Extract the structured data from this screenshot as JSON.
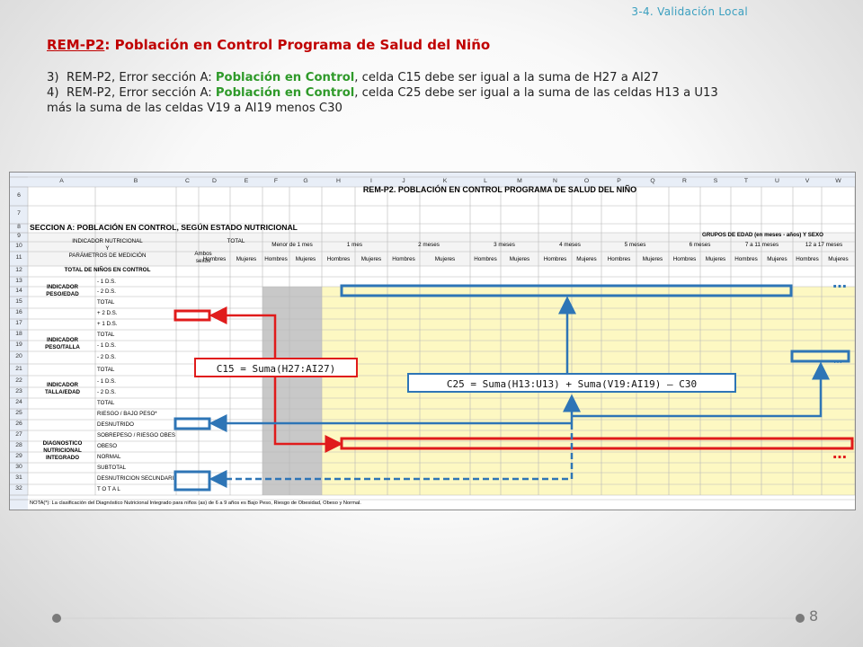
{
  "header": {
    "section_tag": "3-4. Validación Local"
  },
  "title": {
    "code": "REM-P2",
    "text": ": Población en Control  Programa de Salud del Niño"
  },
  "notes": [
    {
      "num": "3)",
      "pre": "REM-P2, Error sección A: ",
      "highlight": "Población en Control",
      "post": ", celda C15 debe ser igual a la suma de H27 a AI27"
    },
    {
      "num": "4)",
      "pre": "REM-P2, Error sección A: ",
      "highlight": "Población en Control",
      "post": ", celda C25 debe ser igual a la suma de las celdas H13 a U13",
      "continuation": "más la suma  de las celdas V19 a AI19 menos C30"
    }
  ],
  "sheet": {
    "col_letters": [
      "A",
      "B",
      "C",
      "D",
      "E",
      "F",
      "G",
      "H",
      "I",
      "J",
      "K",
      "L",
      "M",
      "N",
      "O",
      "P",
      "Q",
      "R",
      "S",
      "T",
      "U",
      "V",
      "W"
    ],
    "row_numbers": [
      "6",
      "7",
      "8",
      "9",
      "10",
      "11",
      "12",
      "13",
      "14",
      "15",
      "16",
      "17",
      "18",
      "19",
      "20",
      "21",
      "22",
      "23",
      "24",
      "25",
      "26",
      "27",
      "28",
      "29",
      "30",
      "31",
      "32"
    ],
    "title": "REM-P2.  POBLACIÓN EN CONTROL PROGRAMA DE SALUD DEL NIÑO",
    "section": "SECCION A: POBLACIÓN EN CONTROL, SEGÚN ESTADO NUTRICIONAL",
    "grupos_edad": "GRUPOS DE EDAD (en meses - años) Y SEXO",
    "indicador_header": [
      "INDICADOR NUTRICIONAL",
      "Y",
      "PARÁMETROS DE MEDICIÓN"
    ],
    "total_header": "TOTAL",
    "ambos_sexos": [
      "Ambos",
      "sexos"
    ],
    "hombres": "Hombres",
    "mujeres": "Mujeres",
    "age_groups": [
      "Menor de 1 mes",
      "1 mes",
      "2 meses",
      "3 meses",
      "4 meses",
      "5 meses",
      "6 meses",
      "7 a 11 meses",
      "12 a 17 meses"
    ],
    "total_ninos": "TOTAL DE NIÑOS EN CONTROL",
    "groups": [
      {
        "name": [
          "INDICADOR",
          "PESO/EDAD"
        ]
      },
      {
        "name": [
          "INDICADOR",
          "PESO/TALLA"
        ]
      },
      {
        "name": [
          "INDICADOR",
          "TALLA/EDAD"
        ]
      },
      {
        "name": [
          "DIAGNOSTICO",
          "NUTRICIONAL",
          "INTEGRADO"
        ]
      }
    ],
    "row_labels": [
      "- 1 D.S.",
      "- 2 D.S.",
      "TOTAL",
      "+ 2 D.S.",
      "+ 1 D.S.",
      "TOTAL",
      "- 1 D.S.",
      "- 2 D.S.",
      "TOTAL",
      "- 1 D.S.",
      "- 2 D.S.",
      "TOTAL",
      "RIESGO / BAJO PESO*",
      "DESNUTRIDO",
      "SOBREPESO / RIESGO OBESIDAD",
      "OBESO",
      "NORMAL",
      "SUBTOTAL",
      "DESNUTRICIÓN SECUNDARIA",
      "T O T A L"
    ],
    "footnote": "NOTA(*): La clasificación del Diagnóstico Nutricional Integrado para niños (as) de 6 a 9 años es Bajo Peso, Riesgo de Obesidad, Obeso y Normal."
  },
  "annotations": {
    "formula_c15": "C15 = Suma(H27:AI27)",
    "formula_c25": "C25 = Suma(H13:U13)  + Suma(V19:AI19) – C30",
    "ellipsis": "…",
    "ellipsis_small": "…",
    "colors": {
      "red": "#e01b1b",
      "blue": "#2e75b6",
      "yellow": "#fdf8c2",
      "gray": "#c8c8c8",
      "header_blue": "#cfe0f1"
    }
  },
  "footer": {
    "page_number": "8"
  }
}
